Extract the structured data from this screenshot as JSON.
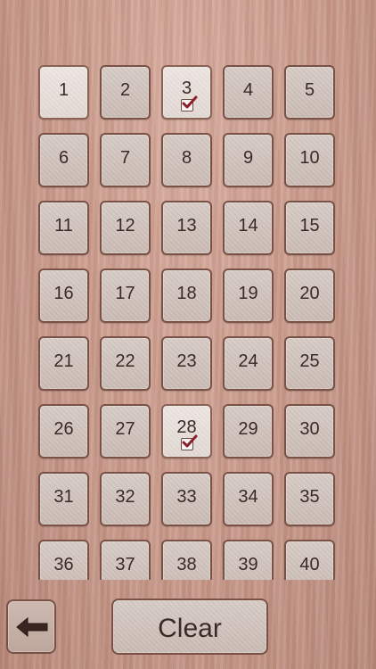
{
  "tiles": [
    {
      "label": "1",
      "selected": true,
      "checked": false
    },
    {
      "label": "2",
      "selected": false,
      "checked": false
    },
    {
      "label": "3",
      "selected": true,
      "checked": true
    },
    {
      "label": "4",
      "selected": false,
      "checked": false
    },
    {
      "label": "5",
      "selected": false,
      "checked": false
    },
    {
      "label": "6",
      "selected": false,
      "checked": false
    },
    {
      "label": "7",
      "selected": false,
      "checked": false
    },
    {
      "label": "8",
      "selected": false,
      "checked": false
    },
    {
      "label": "9",
      "selected": false,
      "checked": false
    },
    {
      "label": "10",
      "selected": false,
      "checked": false
    },
    {
      "label": "11",
      "selected": false,
      "checked": false
    },
    {
      "label": "12",
      "selected": false,
      "checked": false
    },
    {
      "label": "13",
      "selected": false,
      "checked": false
    },
    {
      "label": "14",
      "selected": false,
      "checked": false
    },
    {
      "label": "15",
      "selected": false,
      "checked": false
    },
    {
      "label": "16",
      "selected": false,
      "checked": false
    },
    {
      "label": "17",
      "selected": false,
      "checked": false
    },
    {
      "label": "18",
      "selected": false,
      "checked": false
    },
    {
      "label": "19",
      "selected": false,
      "checked": false
    },
    {
      "label": "20",
      "selected": false,
      "checked": false
    },
    {
      "label": "21",
      "selected": false,
      "checked": false
    },
    {
      "label": "22",
      "selected": false,
      "checked": false
    },
    {
      "label": "23",
      "selected": false,
      "checked": false
    },
    {
      "label": "24",
      "selected": false,
      "checked": false
    },
    {
      "label": "25",
      "selected": false,
      "checked": false
    },
    {
      "label": "26",
      "selected": false,
      "checked": false
    },
    {
      "label": "27",
      "selected": false,
      "checked": false
    },
    {
      "label": "28",
      "selected": true,
      "checked": true
    },
    {
      "label": "29",
      "selected": false,
      "checked": false
    },
    {
      "label": "30",
      "selected": false,
      "checked": false
    },
    {
      "label": "31",
      "selected": false,
      "checked": false
    },
    {
      "label": "32",
      "selected": false,
      "checked": false
    },
    {
      "label": "33",
      "selected": false,
      "checked": false
    },
    {
      "label": "34",
      "selected": false,
      "checked": false
    },
    {
      "label": "35",
      "selected": false,
      "checked": false
    },
    {
      "label": "36",
      "selected": false,
      "checked": false
    },
    {
      "label": "37",
      "selected": false,
      "checked": false
    },
    {
      "label": "38",
      "selected": false,
      "checked": false
    },
    {
      "label": "39",
      "selected": false,
      "checked": false
    },
    {
      "label": "40",
      "selected": false,
      "checked": false
    }
  ],
  "toolbar": {
    "back_icon": "arrow-left-icon",
    "clear_label": "Clear"
  },
  "colors": {
    "wood_background": "#c99a8b",
    "tile_fill": "#cbbcb5",
    "tile_selected_fill": "#e2d8d3",
    "tile_border": "#7a5145",
    "text": "#3a2a26",
    "checkmark": "#8b1e2a"
  }
}
